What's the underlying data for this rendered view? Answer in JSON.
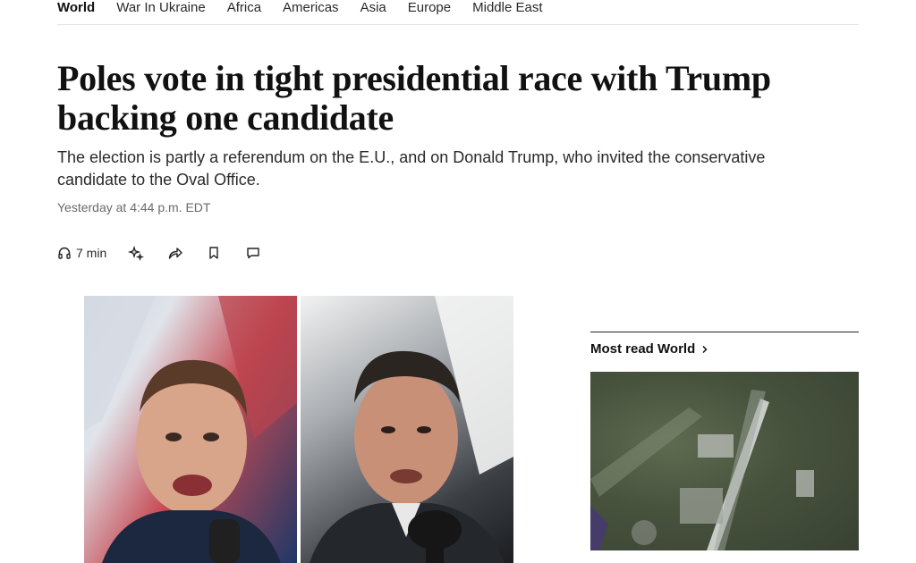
{
  "nav": {
    "items": [
      {
        "label": "World",
        "active": true
      },
      {
        "label": "War In Ukraine"
      },
      {
        "label": "Africa"
      },
      {
        "label": "Americas"
      },
      {
        "label": "Asia"
      },
      {
        "label": "Europe"
      },
      {
        "label": "Middle East"
      }
    ]
  },
  "article": {
    "headline": "Poles vote in tight presidential race with Trump backing one candidate",
    "dek": "The election is partly a referendum on the E.U., and on Donald Trump, who invited the conservative candidate to the Oval Office.",
    "timestamp": "Yesterday at 4:44 p.m. EDT",
    "listen_duration": "7 min"
  },
  "action_icons": [
    "headphones-icon",
    "sparkle-icon",
    "share-icon",
    "bookmark-icon",
    "comment-icon"
  ],
  "sidebar": {
    "section_title": "Most read World"
  },
  "colors": {
    "text": "#111111",
    "muted": "#6a6a6a",
    "rule": "#e3e3e3"
  }
}
